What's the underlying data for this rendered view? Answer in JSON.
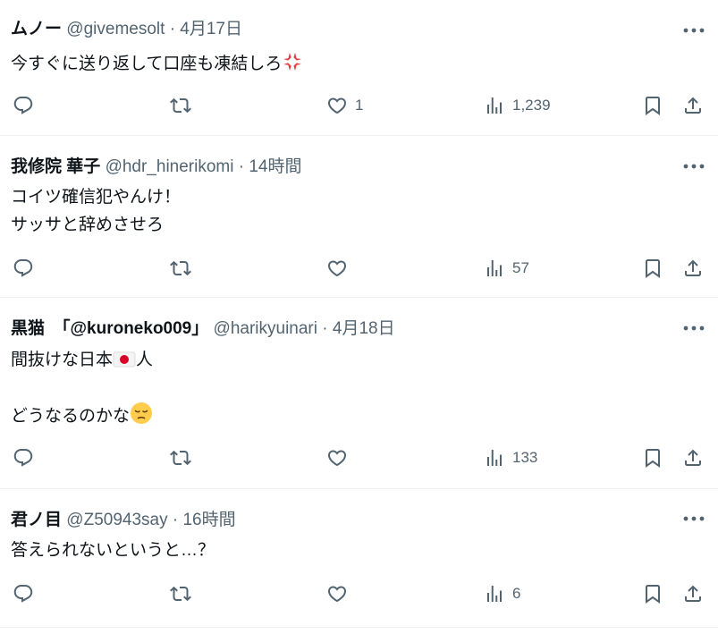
{
  "replies": [
    {
      "name": "ムノー",
      "handle": "@givemesolt",
      "separator": "·",
      "time": "4月17日",
      "lines": [
        "今すぐに送り返して口座も凍結しろ"
      ],
      "emoji": "anger-symbol",
      "likes": "1",
      "views": "1,239"
    },
    {
      "name": "我修院 華子",
      "handle": "@hdr_hinerikomi",
      "separator": "·",
      "time": "14時間",
      "lines": [
        "コイツ確信犯やんけ！",
        "サッサと辞めさせろ"
      ],
      "likes": "",
      "views": "57"
    },
    {
      "name": "黒猫　「@kuroneko009」",
      "handle": "@harikyuinari",
      "separator": "·",
      "time": "4月18日",
      "line1_before_flag": "間抜けな日本",
      "line1_after_flag": "人",
      "line3": "どうなるのかな",
      "flag_icon": "japan-flag",
      "emoji": "pensive-face",
      "likes": "",
      "views": "133"
    },
    {
      "name": "君ノ目",
      "handle": "@Z50943say",
      "separator": "·",
      "time": "16時間",
      "lines": [
        "答えられないというと…？"
      ],
      "likes": "",
      "views": "6"
    }
  ],
  "icons": [
    "more-icon",
    "reply-icon",
    "retweet-icon",
    "like-icon",
    "views-icon",
    "bookmark-icon",
    "share-icon"
  ],
  "colors": {
    "text": "#0f1419",
    "secondary": "#536471",
    "divider": "#eff3f4",
    "flag_red": "#d80027"
  }
}
